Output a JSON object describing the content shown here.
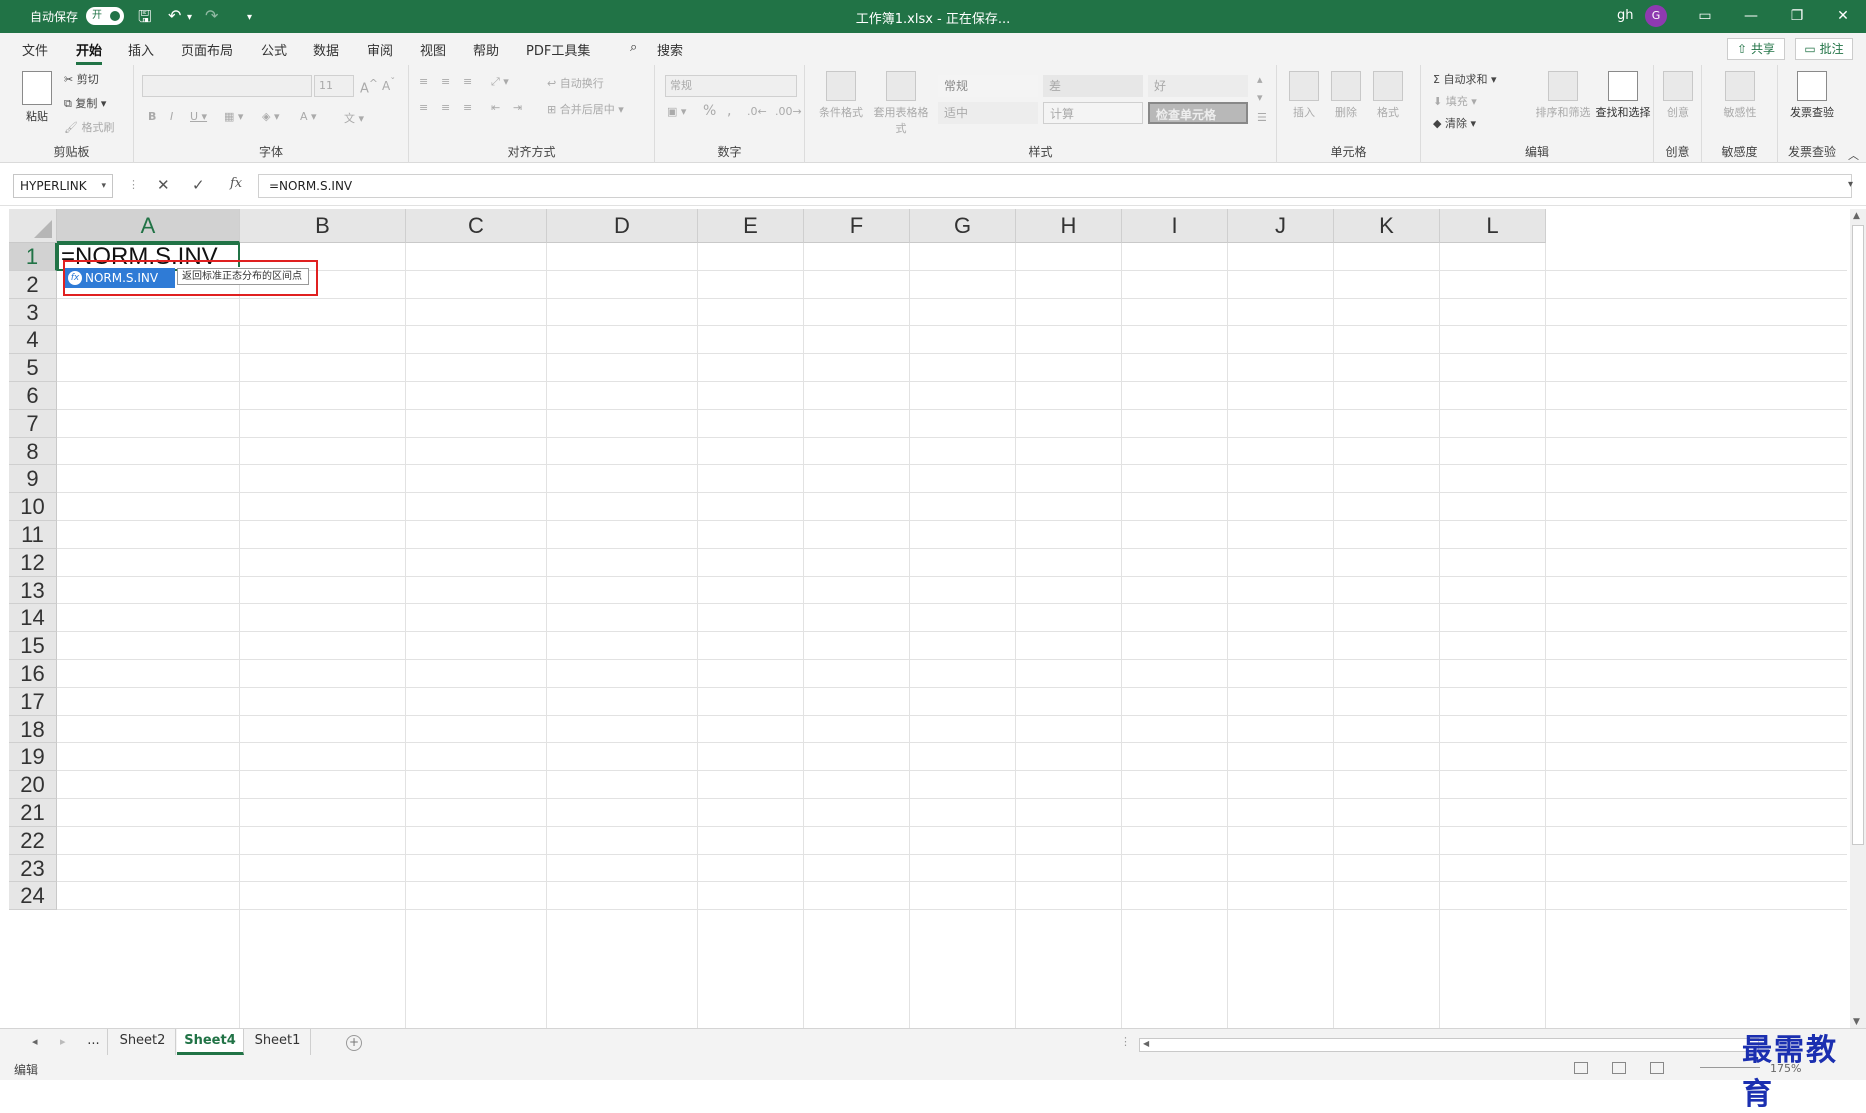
{
  "titlebar": {
    "autosave_label": "自动保存",
    "autosave_state": "开",
    "title": "工作簿1.xlsx - 正在保存...",
    "user": "gh",
    "avatar_initial": "G"
  },
  "menu": {
    "tabs": [
      "文件",
      "开始",
      "插入",
      "页面布局",
      "公式",
      "数据",
      "审阅",
      "视图",
      "帮助",
      "PDF工具集"
    ],
    "active_tab": "开始",
    "search_label": "搜索",
    "share_label": "共享",
    "comment_label": "批注"
  },
  "ribbon": {
    "clipboard": {
      "label": "剪贴板",
      "paste": "粘贴",
      "cut": "剪切",
      "copy": "复制",
      "format_painter": "格式刷"
    },
    "font": {
      "label": "字体",
      "font_name": "",
      "font_size": "11"
    },
    "alignment": {
      "label": "对齐方式",
      "wrap": "自动换行",
      "merge": "合并后居中"
    },
    "number": {
      "label": "数字",
      "format": "常规"
    },
    "styles": {
      "label": "样式",
      "conditional": "条件格式",
      "as_table": "套用表格格式",
      "cells": [
        "常规",
        "差",
        "好",
        "适中",
        "计算",
        "检查单元格"
      ]
    },
    "cells": {
      "label": "单元格",
      "insert": "插入",
      "delete": "删除",
      "format": "格式"
    },
    "editing": {
      "label": "编辑",
      "autosum": "自动求和",
      "fill": "填充",
      "clear": "清除",
      "sort": "排序和筛选",
      "find": "查找和选择"
    },
    "creativity": {
      "label": "创意",
      "btn": "创意"
    },
    "sensitivity": {
      "label": "敏感度",
      "btn": "敏感性"
    },
    "invoice": {
      "label": "发票查验",
      "btn": "发票查验"
    }
  },
  "formula_bar": {
    "name_box": "HYPERLINK",
    "formula": "=NORM.S.INV",
    "fx_label": "fx"
  },
  "grid": {
    "columns": [
      "A",
      "B",
      "C",
      "D",
      "E",
      "F",
      "G",
      "H",
      "I",
      "J",
      "K",
      "L"
    ],
    "rows": [
      "1",
      "2",
      "3",
      "4",
      "5",
      "6",
      "7",
      "8",
      "9",
      "10",
      "11",
      "12",
      "13",
      "14",
      "15",
      "16",
      "17",
      "18",
      "19",
      "20",
      "21",
      "22",
      "23",
      "24"
    ],
    "active_cell_text": "=NORM.S.INV",
    "autocomplete": {
      "item": "NORM.S.INV",
      "tooltip": "返回标准正态分布的区间点"
    }
  },
  "sheets": {
    "ellipsis": "...",
    "tabs": [
      "Sheet2",
      "Sheet4",
      "Sheet1"
    ],
    "active": "Sheet4"
  },
  "status": {
    "mode": "编辑",
    "zoom": "175%"
  },
  "watermark": "最需教育",
  "colors": {
    "accent": "#217346",
    "highlight": "#e02020",
    "autocomplete": "#2f7bd6"
  }
}
